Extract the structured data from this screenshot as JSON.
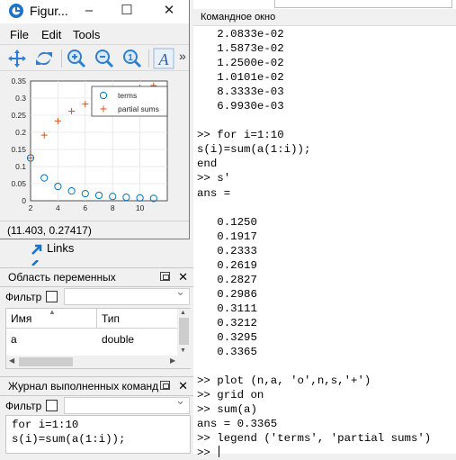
{
  "command_window": {
    "title": "Командное окно",
    "lines": [
      "   2.0833e-02",
      "   1.5873e-02",
      "   1.2500e-02",
      "   1.0101e-02",
      "   8.3333e-03",
      "   6.9930e-03",
      "",
      ">> for i=1:10",
      "s(i)=sum(a(1:i));",
      "end",
      ">> s'",
      "ans =",
      "",
      "   0.1250",
      "   0.1917",
      "   0.2333",
      "   0.2619",
      "   0.2827",
      "   0.2986",
      "   0.3111",
      "   0.3212",
      "   0.3295",
      "   0.3365",
      "",
      ">> plot (n,a, 'o',n,s,'+')",
      ">> grid on",
      ">> sum(a)",
      "ans = 0.3365",
      ">> legend ('terms', 'partial sums')"
    ],
    "prompt": ">> "
  },
  "figure": {
    "title": "Figur...",
    "menu": [
      "File",
      "Edit",
      "Tools"
    ],
    "icons": [
      "pan-icon",
      "rotate-icon",
      "zoom-in-icon",
      "zoom-out-icon",
      "zoom-1-icon",
      "insert-text-icon"
    ],
    "more": "»",
    "status_coords": "(11.403, 0.27417)"
  },
  "chart_data": {
    "type": "scatter",
    "title": "",
    "xlabel": "",
    "ylabel": "",
    "xlim": [
      2,
      12
    ],
    "ylim": [
      0,
      0.35
    ],
    "xticks": [
      "2",
      "4",
      "6",
      "8",
      "10"
    ],
    "yticks": [
      "0",
      "0.05",
      "0.1",
      "0.15",
      "0.2",
      "0.25",
      "0.3",
      "0.35"
    ],
    "grid": true,
    "legend_position": "top-right",
    "series": [
      {
        "name": "terms",
        "marker": "o",
        "color": "#0072bd",
        "x": [
          2,
          3,
          4,
          5,
          6,
          7,
          8,
          9,
          10,
          11
        ],
        "y": [
          0.125,
          0.0667,
          0.0417,
          0.0286,
          0.0208,
          0.0159,
          0.0125,
          0.0101,
          0.0083,
          0.007
        ]
      },
      {
        "name": "partial sums",
        "marker": "+",
        "color": "#d95319",
        "x": [
          2,
          3,
          4,
          5,
          6,
          7,
          8,
          9,
          10,
          11
        ],
        "y": [
          0.125,
          0.1917,
          0.2333,
          0.2619,
          0.2827,
          0.2986,
          0.3111,
          0.3212,
          0.3295,
          0.3365
        ]
      }
    ]
  },
  "links": {
    "label": "Links"
  },
  "workspace": {
    "title": "Область переменных",
    "filter_label": "Фильтр",
    "columns": [
      "Имя",
      "Тип"
    ],
    "rows": [
      {
        "name": "a",
        "type": "double"
      }
    ]
  },
  "history": {
    "title": "Журнал выполненных команд",
    "filter_label": "Фильтр",
    "lines": [
      "for i=1:10",
      "s(i)=sum(a(1:i));"
    ]
  }
}
